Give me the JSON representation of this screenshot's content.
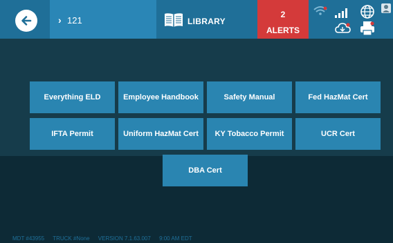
{
  "header": {
    "route_number": "121",
    "section_title": "LIBRARY",
    "alerts": {
      "count": "2",
      "label": "ALERTS"
    }
  },
  "icons": {
    "back": "arrow-left-icon",
    "route": "chevron-right-icon",
    "library": "book-icon",
    "status": [
      "wifi-icon",
      "signal-bars-icon",
      "globe-icon",
      "cloud-sync-icon",
      "printer-icon",
      "profile-icon"
    ]
  },
  "documents": [
    "Everything ELD",
    "Employee Handbook",
    "Safety Manual",
    "Fed HazMat Cert",
    "IFTA Permit",
    "Uniform HazMat Cert",
    "KY Tobacco Permit",
    "UCR Cert",
    "DBA Cert"
  ],
  "footer": {
    "mdt": "MDT #43955",
    "truck": "TRUCK #None",
    "version": "VERSION  7.1.63.007",
    "time": "9:00 AM EDT"
  },
  "colors": {
    "header": "#1f6f98",
    "route_panel": "#2a86b6",
    "alert": "#d43a3a",
    "content_band": "#163c4b",
    "background": "#0d2a36",
    "button": "#2a85b1"
  }
}
